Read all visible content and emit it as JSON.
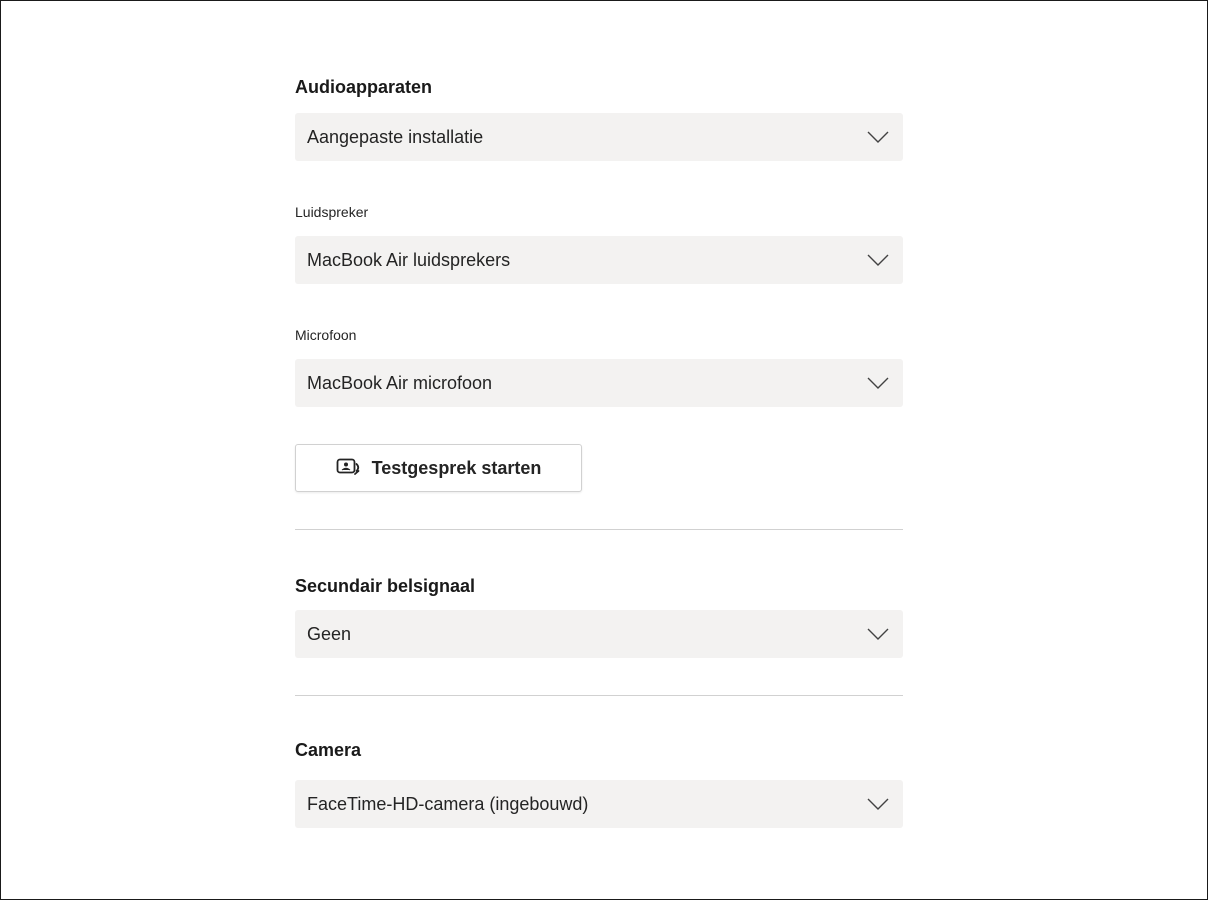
{
  "audio": {
    "title": "Audioapparaten",
    "device_setup": "Aangepaste installatie",
    "speaker_label": "Luidspreker",
    "speaker_value": "MacBook Air luidsprekers",
    "mic_label": "Microfoon",
    "mic_value": "MacBook Air microfoon",
    "test_call_button": "Testgesprek starten"
  },
  "ringer": {
    "title": "Secundair belsignaal",
    "value": "Geen"
  },
  "camera": {
    "title": "Camera",
    "value": "FaceTime-HD-camera (ingebouwd)"
  },
  "icons": {
    "dropdown": "chevron-down-icon",
    "test_call": "test-call-icon"
  }
}
